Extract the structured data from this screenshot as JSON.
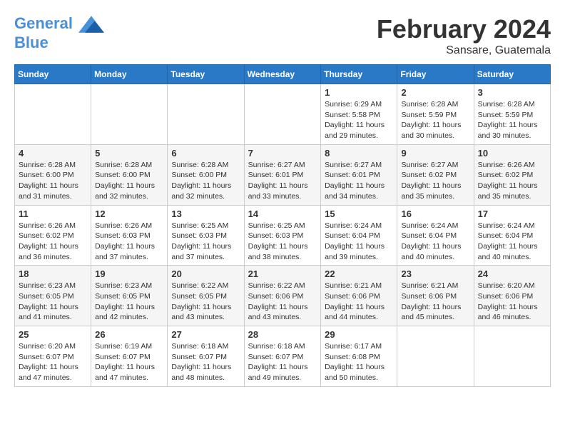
{
  "header": {
    "logo_line1": "General",
    "logo_line2": "Blue",
    "month": "February 2024",
    "location": "Sansare, Guatemala"
  },
  "weekdays": [
    "Sunday",
    "Monday",
    "Tuesday",
    "Wednesday",
    "Thursday",
    "Friday",
    "Saturday"
  ],
  "weeks": [
    [
      {
        "day": "",
        "info": ""
      },
      {
        "day": "",
        "info": ""
      },
      {
        "day": "",
        "info": ""
      },
      {
        "day": "",
        "info": ""
      },
      {
        "day": "1",
        "info": "Sunrise: 6:29 AM\nSunset: 5:58 PM\nDaylight: 11 hours\nand 29 minutes."
      },
      {
        "day": "2",
        "info": "Sunrise: 6:28 AM\nSunset: 5:59 PM\nDaylight: 11 hours\nand 30 minutes."
      },
      {
        "day": "3",
        "info": "Sunrise: 6:28 AM\nSunset: 5:59 PM\nDaylight: 11 hours\nand 30 minutes."
      }
    ],
    [
      {
        "day": "4",
        "info": "Sunrise: 6:28 AM\nSunset: 6:00 PM\nDaylight: 11 hours\nand 31 minutes."
      },
      {
        "day": "5",
        "info": "Sunrise: 6:28 AM\nSunset: 6:00 PM\nDaylight: 11 hours\nand 32 minutes."
      },
      {
        "day": "6",
        "info": "Sunrise: 6:28 AM\nSunset: 6:00 PM\nDaylight: 11 hours\nand 32 minutes."
      },
      {
        "day": "7",
        "info": "Sunrise: 6:27 AM\nSunset: 6:01 PM\nDaylight: 11 hours\nand 33 minutes."
      },
      {
        "day": "8",
        "info": "Sunrise: 6:27 AM\nSunset: 6:01 PM\nDaylight: 11 hours\nand 34 minutes."
      },
      {
        "day": "9",
        "info": "Sunrise: 6:27 AM\nSunset: 6:02 PM\nDaylight: 11 hours\nand 35 minutes."
      },
      {
        "day": "10",
        "info": "Sunrise: 6:26 AM\nSunset: 6:02 PM\nDaylight: 11 hours\nand 35 minutes."
      }
    ],
    [
      {
        "day": "11",
        "info": "Sunrise: 6:26 AM\nSunset: 6:02 PM\nDaylight: 11 hours\nand 36 minutes."
      },
      {
        "day": "12",
        "info": "Sunrise: 6:26 AM\nSunset: 6:03 PM\nDaylight: 11 hours\nand 37 minutes."
      },
      {
        "day": "13",
        "info": "Sunrise: 6:25 AM\nSunset: 6:03 PM\nDaylight: 11 hours\nand 37 minutes."
      },
      {
        "day": "14",
        "info": "Sunrise: 6:25 AM\nSunset: 6:03 PM\nDaylight: 11 hours\nand 38 minutes."
      },
      {
        "day": "15",
        "info": "Sunrise: 6:24 AM\nSunset: 6:04 PM\nDaylight: 11 hours\nand 39 minutes."
      },
      {
        "day": "16",
        "info": "Sunrise: 6:24 AM\nSunset: 6:04 PM\nDaylight: 11 hours\nand 40 minutes."
      },
      {
        "day": "17",
        "info": "Sunrise: 6:24 AM\nSunset: 6:04 PM\nDaylight: 11 hours\nand 40 minutes."
      }
    ],
    [
      {
        "day": "18",
        "info": "Sunrise: 6:23 AM\nSunset: 6:05 PM\nDaylight: 11 hours\nand 41 minutes."
      },
      {
        "day": "19",
        "info": "Sunrise: 6:23 AM\nSunset: 6:05 PM\nDaylight: 11 hours\nand 42 minutes."
      },
      {
        "day": "20",
        "info": "Sunrise: 6:22 AM\nSunset: 6:05 PM\nDaylight: 11 hours\nand 43 minutes."
      },
      {
        "day": "21",
        "info": "Sunrise: 6:22 AM\nSunset: 6:06 PM\nDaylight: 11 hours\nand 43 minutes."
      },
      {
        "day": "22",
        "info": "Sunrise: 6:21 AM\nSunset: 6:06 PM\nDaylight: 11 hours\nand 44 minutes."
      },
      {
        "day": "23",
        "info": "Sunrise: 6:21 AM\nSunset: 6:06 PM\nDaylight: 11 hours\nand 45 minutes."
      },
      {
        "day": "24",
        "info": "Sunrise: 6:20 AM\nSunset: 6:06 PM\nDaylight: 11 hours\nand 46 minutes."
      }
    ],
    [
      {
        "day": "25",
        "info": "Sunrise: 6:20 AM\nSunset: 6:07 PM\nDaylight: 11 hours\nand 47 minutes."
      },
      {
        "day": "26",
        "info": "Sunrise: 6:19 AM\nSunset: 6:07 PM\nDaylight: 11 hours\nand 47 minutes."
      },
      {
        "day": "27",
        "info": "Sunrise: 6:18 AM\nSunset: 6:07 PM\nDaylight: 11 hours\nand 48 minutes."
      },
      {
        "day": "28",
        "info": "Sunrise: 6:18 AM\nSunset: 6:07 PM\nDaylight: 11 hours\nand 49 minutes."
      },
      {
        "day": "29",
        "info": "Sunrise: 6:17 AM\nSunset: 6:08 PM\nDaylight: 11 hours\nand 50 minutes."
      },
      {
        "day": "",
        "info": ""
      },
      {
        "day": "",
        "info": ""
      }
    ]
  ]
}
